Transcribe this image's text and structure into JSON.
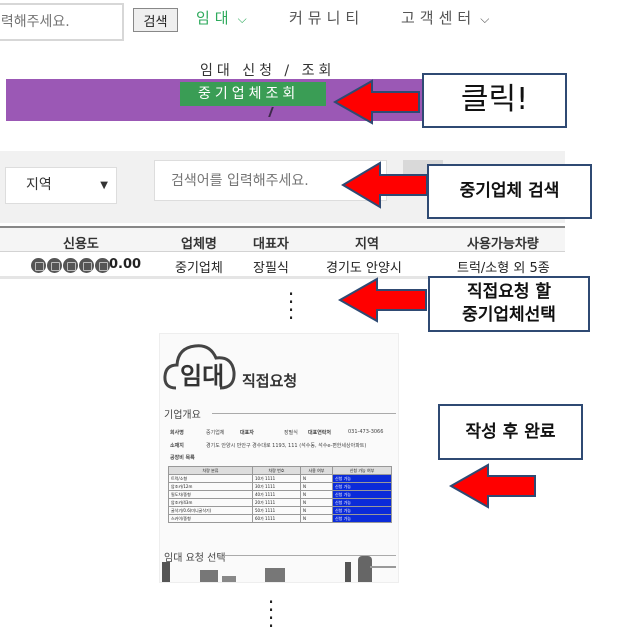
{
  "header": {
    "search_placeholder": "검색어를 입력해주세요.",
    "search_button": "검색",
    "nav": [
      {
        "label": "임대",
        "active": true
      },
      {
        "label": "커뮤니티"
      },
      {
        "label": "고객센터"
      }
    ],
    "dropdown": {
      "item1": "임대 신청 / 조회",
      "item2": "중기업체조회"
    }
  },
  "search": {
    "region_selected": "지역",
    "keyword_placeholder": "검색어를 입력해주세요.",
    "search_button_partial": "색"
  },
  "table": {
    "headers": [
      "신용도",
      "업체명",
      "대표자",
      "지역",
      "사용가능차량"
    ],
    "row": {
      "rating_value": "0.00",
      "company": "중기업체",
      "representative": "장필식",
      "region": "경기도 안양시",
      "vehicles": "트럭/소형 외 5종"
    }
  },
  "callouts": {
    "click": "클릭!",
    "search_company": "중기업체 검색",
    "select_line1": "직접요청 할",
    "select_line2": "중기업체선택",
    "complete": "작성 후 완료"
  },
  "doc_preview": {
    "logo": "임대",
    "subtitle": "직접요청",
    "section1": "기업개요",
    "company_label": "회사명",
    "company_value": "중기업체",
    "rep_label": "대표자",
    "rep_value": "장필식",
    "contact_label": "대표연락처",
    "contact_value": "031-473-3066",
    "address_label": "소재지",
    "address_value": "경기도 안양시 만안구 경수대로 1193, 111 (석수동, 석수e-편한세상아파트)",
    "cert_label": "공장비 목록",
    "table_headers": [
      "차량 분류",
      "차량 번호",
      "사용 여부",
      "신청 가능 여부"
    ],
    "table_rows": [
      [
        "트럭/소형",
        "10가 1111",
        "N",
        "신청 가능"
      ],
      [
        "암조카/12m",
        "30가 1111",
        "N",
        "신청 가능"
      ],
      [
        "필도차/중형",
        "40가 1111",
        "N",
        "신청 가능"
      ],
      [
        "암조카/43m",
        "20가 1111",
        "N",
        "신청 가능"
      ],
      [
        "굴삭기/0.6(미니굴삭기)",
        "50가 1111",
        "N",
        "신청 가능"
      ],
      [
        "스카이/중형",
        "60가 1111",
        "N",
        "신청 가능"
      ]
    ],
    "section2": "임대 요청 선택"
  },
  "colors": {
    "accent_green": "#2eaa5c",
    "menu_green": "#3a9d55",
    "purple_bar": "#9b58b5",
    "arrow_red": "#ff0000",
    "callout_border": "#2f4a73",
    "doc_blue": "#0b2bd9"
  }
}
